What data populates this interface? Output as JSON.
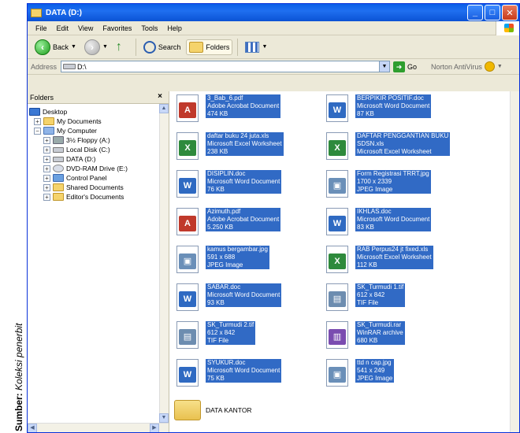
{
  "caption": {
    "bold": "Sumber:",
    "italic": "Koleksi penerbit"
  },
  "window": {
    "title": "DATA (D:)"
  },
  "menu": [
    "File",
    "Edit",
    "View",
    "Favorites",
    "Tools",
    "Help"
  ],
  "toolbar": {
    "back": "Back",
    "search": "Search",
    "folders": "Folders"
  },
  "address": {
    "label": "Address",
    "value": "D:\\",
    "go": "Go",
    "norton": "Norton AntiVirus"
  },
  "folders_pane": {
    "title": "Folders",
    "tree": [
      {
        "label": "Desktop",
        "icon": "desktop-icon",
        "level": 0,
        "expander": ""
      },
      {
        "label": "My Documents",
        "icon": "folder-icon",
        "level": 1,
        "expander": "+"
      },
      {
        "label": "My Computer",
        "icon": "computer-icon",
        "level": 1,
        "expander": "−"
      },
      {
        "label": "3½ Floppy (A:)",
        "icon": "floppy-icon",
        "level": 2,
        "expander": "+"
      },
      {
        "label": "Local Disk (C:)",
        "icon": "drive-icon",
        "level": 2,
        "expander": "+"
      },
      {
        "label": "DATA (D:)",
        "icon": "drive-icon",
        "level": 2,
        "expander": "+"
      },
      {
        "label": "DVD-RAM Drive (E:)",
        "icon": "dvd-icon",
        "level": 2,
        "expander": "+"
      },
      {
        "label": "Control Panel",
        "icon": "control-panel-icon",
        "level": 2,
        "expander": "+"
      },
      {
        "label": "Shared Documents",
        "icon": "folder-icon",
        "level": 2,
        "expander": "+"
      },
      {
        "label": "Editor's Documents",
        "icon": "folder-icon",
        "level": 2,
        "expander": "+"
      }
    ]
  },
  "files": [
    {
      "name": "3_Bab_6.pdf",
      "type": "Adobe Acrobat Document",
      "size": "474 KB",
      "kind": "pdf",
      "glyph": "A"
    },
    {
      "name": "BERPIKIR POSITIF.doc",
      "type": "Microsoft Word Document",
      "size": "87 KB",
      "kind": "doc",
      "glyph": "W"
    },
    {
      "name": "daftar buku 24 juta.xls",
      "type": "Microsoft Excel Worksheet",
      "size": "238 KB",
      "kind": "xls",
      "glyph": "X"
    },
    {
      "name": "DAFTAR PENGGANTIAN BUKU",
      "type": "SDSN.xls",
      "size": "Microsoft Excel Worksheet",
      "kind": "xls",
      "glyph": "X"
    },
    {
      "name": "DISIPLIN.doc",
      "type": "Microsoft Word Document",
      "size": "76 KB",
      "kind": "doc",
      "glyph": "W"
    },
    {
      "name": "Form Registrasi TRRT.jpg",
      "type": "1700 x 2339",
      "size": "JPEG Image",
      "kind": "jpg",
      "glyph": "▣"
    },
    {
      "name": "Azimuth.pdf",
      "type": "Adobe Acrobat Document",
      "size": "5.250 KB",
      "kind": "pdf",
      "glyph": "A"
    },
    {
      "name": "IKHLAS.doc",
      "type": "Microsoft Word Document",
      "size": "83 KB",
      "kind": "doc",
      "glyph": "W"
    },
    {
      "name": "kamus bergambar.jpg",
      "type": "591 x 688",
      "size": "JPEG Image",
      "kind": "jpg",
      "glyph": "▣"
    },
    {
      "name": "RAB Perpus24 jt fixed.xls",
      "type": "Microsoft Excel Worksheet",
      "size": "112 KB",
      "kind": "xls",
      "glyph": "X"
    },
    {
      "name": "SABAR.doc",
      "type": "Microsoft Word Document",
      "size": "93 KB",
      "kind": "doc",
      "glyph": "W"
    },
    {
      "name": "SK_Turmudi 1.tif",
      "type": "612 x 842",
      "size": "TIF File",
      "kind": "tif",
      "glyph": "▤"
    },
    {
      "name": "SK_Turmudi 2.tif",
      "type": "612 x 842",
      "size": "TIF File",
      "kind": "tif",
      "glyph": "▤"
    },
    {
      "name": "SK_Turmudi.rar",
      "type": "WinRAR archive",
      "size": "680 KB",
      "kind": "rar",
      "glyph": "▥"
    },
    {
      "name": "SYUKUR.doc",
      "type": "Microsoft Word Document",
      "size": "75 KB",
      "kind": "doc",
      "glyph": "W"
    },
    {
      "name": "ttd n cap.jpg",
      "type": "541 x 249",
      "size": "JPEG Image",
      "kind": "jpg",
      "glyph": "▣"
    }
  ],
  "folder_item": {
    "name": "DATA KANTOR"
  }
}
